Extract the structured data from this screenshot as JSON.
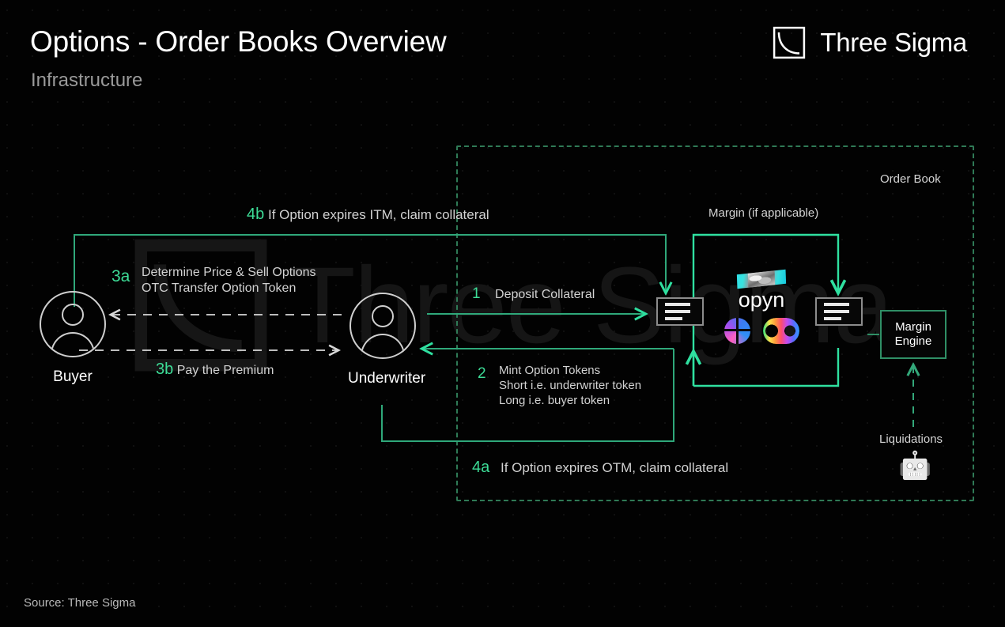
{
  "header": {
    "title": "Options - Order Books Overview",
    "subtitle": "Infrastructure",
    "brand": "Three Sigma",
    "brand_mark_icon": "three-sigma-square-curve-icon"
  },
  "watermark": {
    "text": "Three Sigma",
    "mark_icon": "three-sigma-square-curve-icon"
  },
  "regions": {
    "order_book_label": "Order Book",
    "margin_label": "Margin (if applicable)"
  },
  "actors": [
    {
      "id": "buyer",
      "name": "Buyer",
      "icon": "user-circle-icon"
    },
    {
      "id": "underwriter",
      "name": "Underwriter",
      "icon": "user-circle-icon"
    }
  ],
  "order_books": [
    {
      "id": "left",
      "icon": "order-book-list-icon"
    },
    {
      "id": "right",
      "icon": "order-book-list-icon"
    }
  ],
  "protocol": {
    "name": "opyn",
    "logo_icon": "opyn-logo-icon",
    "coins": [
      {
        "id": "dopex",
        "icon": "dopex-coin-icon"
      },
      {
        "id": "rainbow",
        "icon": "rainbow-peanut-coin-icon"
      }
    ]
  },
  "margin_engine": {
    "line1": "Margin",
    "line2": "Engine"
  },
  "liquidations": {
    "label": "Liquidations",
    "icon": "robot-icon",
    "glyph": "🤖"
  },
  "steps": [
    {
      "id": "1",
      "num": "1",
      "text": "Deposit Collateral"
    },
    {
      "id": "2",
      "num": "2",
      "text": "Mint Option Tokens\nShort i.e. underwriter token\nLong i.e. buyer token"
    },
    {
      "id": "3a",
      "num": "3a",
      "text": "Determine Price & Sell Options\nOTC Transfer Option Token"
    },
    {
      "id": "3b",
      "num": "3b",
      "text": "Pay the Premium"
    },
    {
      "id": "4a",
      "num": "4a",
      "text": "If Option expires OTM, claim collateral"
    },
    {
      "id": "4b",
      "num": "4b",
      "text": "If Option expires ITM, claim collateral"
    }
  ],
  "footer": {
    "source": "Source: Three Sigma"
  },
  "colors": {
    "background": "#000000",
    "accent_green": "#3ddc97",
    "accent_teal": "#2fe0a0",
    "region_border": "#2f7a56",
    "text_primary": "#ffffff",
    "text_secondary": "#d2d2d2",
    "text_muted": "#9a9a9a",
    "arrow_white": "#d8d8d8"
  }
}
